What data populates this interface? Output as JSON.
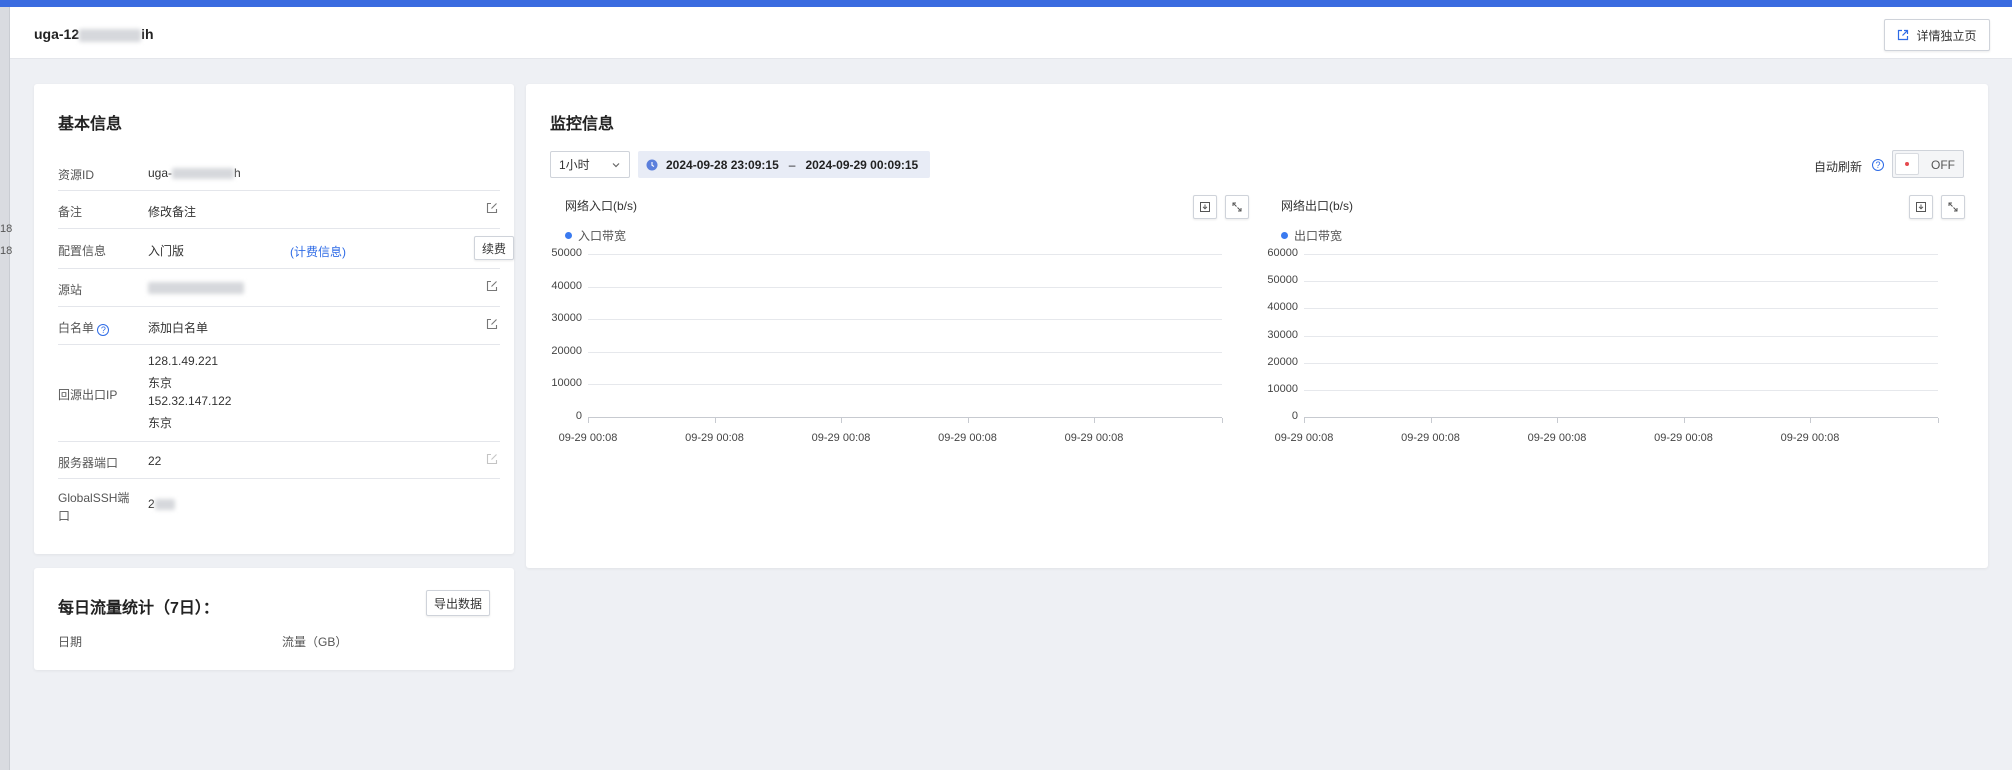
{
  "header": {
    "title_prefix": "uga-12",
    "title_suffix": "ih",
    "detail_button": "详情独立页"
  },
  "left_edge": {
    "marks": [
      "18",
      "18"
    ]
  },
  "basic_info": {
    "title": "基本信息",
    "resource_id": {
      "label": "资源ID",
      "value_prefix": "uga-",
      "value_suffix": "h"
    },
    "remark": {
      "label": "备注",
      "placeholder": "修改备注"
    },
    "config": {
      "label": "配置信息",
      "value": "入门版",
      "link": "(计费信息)",
      "renew_button": "续费"
    },
    "origin": {
      "label": "源站"
    },
    "whitelist": {
      "label": "白名单",
      "help": "?",
      "value": "添加白名单"
    },
    "egress_ip": {
      "label": "回源出口IP",
      "lines": [
        "128.1.49.221",
        "东京",
        "152.32.147.122",
        "东京"
      ]
    },
    "server_port": {
      "label": "服务器端口",
      "value": "22"
    },
    "global_ssh_port": {
      "label": "GlobalSSH端口",
      "value_prefix": "2"
    }
  },
  "daily_traffic": {
    "title": "每日流量统计（7日）：",
    "export_button": "导出数据",
    "columns": [
      "日期",
      "流量（GB）"
    ]
  },
  "monitor": {
    "title": "监控信息",
    "range_select": "1小时",
    "time_start": "2024-09-28 23:09:15",
    "time_sep": "–",
    "time_end": "2024-09-29 00:09:15",
    "auto_refresh_label": "自动刷新",
    "help": "?",
    "toggle_label": "OFF"
  },
  "chart_data": [
    {
      "type": "line",
      "title": "网络入口(b/s)",
      "series": [
        {
          "name": "入口带宽",
          "values": []
        }
      ],
      "x_ticks": [
        "09-29 00:08",
        "09-29 00:08",
        "09-29 00:08",
        "09-29 00:08",
        "09-29 00:08"
      ],
      "y_ticks": [
        "50000",
        "40000",
        "30000",
        "20000",
        "10000",
        "0"
      ],
      "ylim": [
        0,
        50000
      ],
      "grid": true,
      "legend": "top-left",
      "color": "#3a7af0"
    },
    {
      "type": "line",
      "title": "网络出口(b/s)",
      "series": [
        {
          "name": "出口带宽",
          "values": []
        }
      ],
      "x_ticks": [
        "09-29 00:08",
        "09-29 00:08",
        "09-29 00:08",
        "09-29 00:08",
        "09-29 00:08"
      ],
      "y_ticks": [
        "60000",
        "50000",
        "40000",
        "30000",
        "20000",
        "10000",
        "0"
      ],
      "ylim": [
        0,
        60000
      ],
      "grid": true,
      "legend": "top-left",
      "color": "#3a7af0"
    }
  ],
  "colors": {
    "accent": "#3a6be0",
    "link": "#2e6be6",
    "toggle_dot": "#e5484d"
  }
}
